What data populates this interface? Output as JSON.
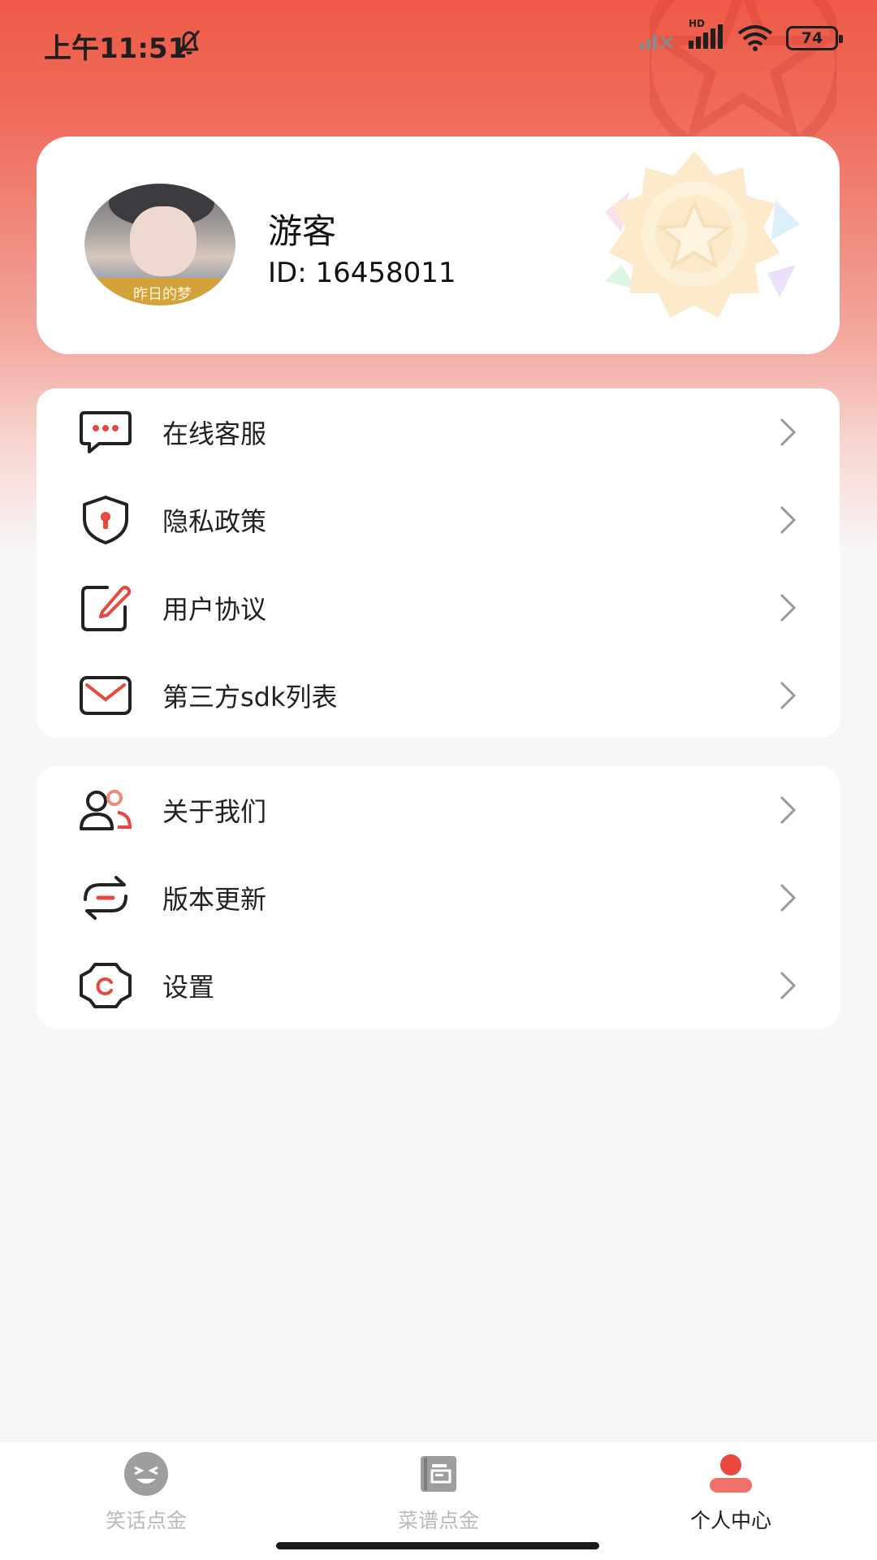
{
  "status_bar": {
    "time": "上午11:51",
    "network_badge": "HD",
    "battery": "74",
    "icons": [
      "bell-off-icon",
      "signal-no-sim-icon",
      "signal-icon",
      "wifi-icon",
      "battery-icon"
    ]
  },
  "profile": {
    "name": "游客",
    "id_text": "ID: 16458011",
    "avatar_caption": "昨日的梦"
  },
  "menu_group_1": [
    {
      "label": "在线客服",
      "icon": "chat-bubble-icon"
    },
    {
      "label": "隐私政策",
      "icon": "shield-icon"
    },
    {
      "label": "用户协议",
      "icon": "edit-icon"
    },
    {
      "label": "第三方sdk列表",
      "icon": "mail-icon"
    }
  ],
  "menu_group_2": [
    {
      "label": "关于我们",
      "icon": "users-icon"
    },
    {
      "label": "版本更新",
      "icon": "refresh-icon"
    },
    {
      "label": "设置",
      "icon": "gear-icon"
    }
  ],
  "tabs": [
    {
      "label": "笑话点金",
      "icon": "laugh-face-icon",
      "active": false
    },
    {
      "label": "菜谱点金",
      "icon": "recipe-book-icon",
      "active": false
    },
    {
      "label": "个人中心",
      "icon": "person-icon",
      "active": true
    }
  ],
  "colors": {
    "accent": "#e8483e",
    "accent_light": "#f08a7a",
    "text": "#222222",
    "muted": "#b9b9b9"
  }
}
